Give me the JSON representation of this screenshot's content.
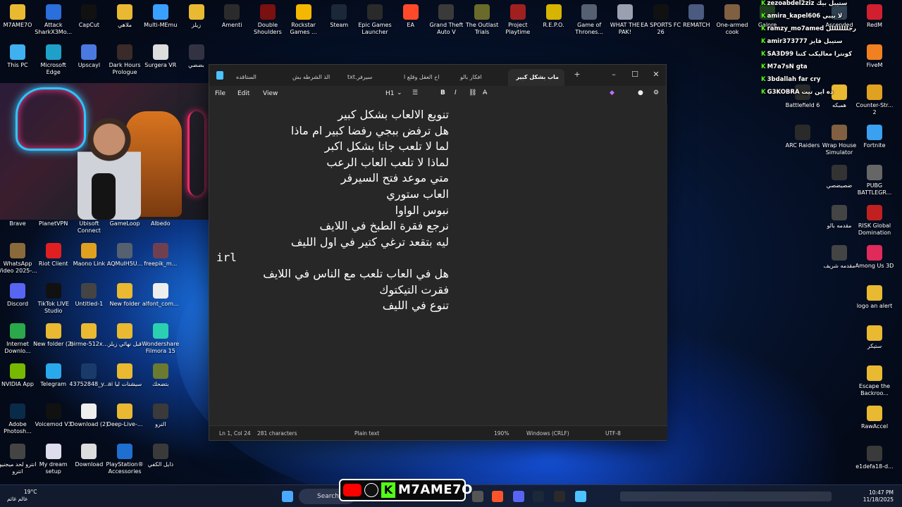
{
  "desktop": {
    "icons_left": [
      {
        "label": "M7AME7O",
        "icon": "folder-icon",
        "color": "#e8b931"
      },
      {
        "label": "Attack SharkX3Mo...",
        "icon": "shark-icon",
        "color": "#2a6fdb"
      },
      {
        "label": "CapCut",
        "icon": "capcut-icon",
        "color": "#111111"
      },
      {
        "label": "ملاهي",
        "icon": "folder-icon",
        "color": "#e8b931"
      },
      {
        "label": "Multi-MEmu",
        "icon": "memu-icon",
        "color": "#3aa0ff"
      },
      {
        "label": "زيلز",
        "icon": "folder-icon",
        "color": "#e8b931"
      },
      {
        "label": "Amenti",
        "icon": "game-icon",
        "color": "#2b2b2b"
      },
      {
        "label": "Double Shoulders",
        "icon": "game-icon",
        "color": "#7a1010"
      },
      {
        "label": "Rockstar Games ...",
        "icon": "rockstar-icon",
        "color": "#f5b800"
      },
      {
        "label": "Steam",
        "icon": "steam-icon",
        "color": "#1b2838"
      },
      {
        "label": "Epic Games Launcher",
        "icon": "epic-icon",
        "color": "#2a2a2a"
      },
      {
        "label": "EA",
        "icon": "ea-icon",
        "color": "#ff4a2a"
      },
      {
        "label": "Grand Theft Auto V",
        "icon": "gta-icon",
        "color": "#3a3a3a"
      },
      {
        "label": "The Outlast Trials",
        "icon": "game-icon",
        "color": "#6a6a2a"
      },
      {
        "label": "Project Playtime",
        "icon": "game-icon",
        "color": "#a02020"
      },
      {
        "label": "R.E.P.O.",
        "icon": "game-icon",
        "color": "#d6b400"
      },
      {
        "label": "Game of Thrones...",
        "icon": "game-icon",
        "color": "#556070"
      },
      {
        "label": "WHAT THE PAK!",
        "icon": "game-icon",
        "color": "#9aa0b0"
      },
      {
        "label": "EA SPORTS FC 26",
        "icon": "game-icon",
        "color": "#111111"
      },
      {
        "label": "REMATCH",
        "icon": "game-icon",
        "color": "#4a5a80"
      },
      {
        "label": "One-armed cook",
        "icon": "game-icon",
        "color": "#806040"
      }
    ],
    "row2": [
      {
        "label": "This PC",
        "icon": "pc-icon",
        "color": "#3fb0f0"
      },
      {
        "label": "Microsoft Edge",
        "icon": "edge-icon",
        "color": "#1fa0c8"
      },
      {
        "label": "Upscayl",
        "icon": "upscayl-icon",
        "color": "#4a7ae0"
      },
      {
        "label": "Dark Hours Prologue",
        "icon": "game-icon",
        "color": "#3a2a2a"
      },
      {
        "label": "Surgera VR",
        "icon": "surgera-icon",
        "color": "#dddddd"
      },
      {
        "label": "بضضي",
        "icon": "shortcut-icon",
        "color": "#333344"
      }
    ],
    "left_column": [
      {
        "label": "Brave",
        "icon": "brave-icon",
        "color": "#fb542b"
      },
      {
        "label": "PlanetVPN",
        "icon": "vpn-icon",
        "color": "#2a8af0"
      },
      {
        "label": "Ubisoft Connect",
        "icon": "ubisoft-icon",
        "color": "#1a1a1a"
      },
      {
        "label": "GameLoop",
        "icon": "gameloop-icon",
        "color": "#1f6fe0"
      },
      {
        "label": "Albedo",
        "icon": "albedo-icon",
        "color": "#aaaaaa"
      },
      {
        "label": "WhatsApp Video 2025-...",
        "icon": "video-icon",
        "color": "#8a6a3a"
      },
      {
        "label": "Riot Client",
        "icon": "riot-icon",
        "color": "#e02020"
      },
      {
        "label": "Maono Link",
        "icon": "maono-icon",
        "color": "#e0a020"
      },
      {
        "label": "AQMulH5U...",
        "icon": "image-icon",
        "color": "#556070"
      },
      {
        "label": "freepik_m...",
        "icon": "image-icon",
        "color": "#704050"
      },
      {
        "label": "Discord",
        "icon": "discord-icon",
        "color": "#5865f2"
      },
      {
        "label": "TikTok LIVE Studio",
        "icon": "tiktok-icon",
        "color": "#111111"
      },
      {
        "label": "Untitled-1",
        "icon": "file-icon",
        "color": "#444444"
      },
      {
        "label": "New folder",
        "icon": "folder-icon",
        "color": "#e8b931"
      },
      {
        "label": "alfont_com...",
        "icon": "font-icon",
        "color": "#eeeeee"
      },
      {
        "label": "Internet Downlo...",
        "icon": "idm-icon",
        "color": "#2aa84a"
      },
      {
        "label": "New folder (2)",
        "icon": "folder-icon",
        "color": "#e8b931"
      },
      {
        "label": "birme-512x...",
        "icon": "folder-icon",
        "color": "#e8b931"
      },
      {
        "label": "قبل نهائي زيلز",
        "icon": "folder-icon",
        "color": "#e8b931"
      },
      {
        "label": "Wondershare Filmora 15",
        "icon": "filmora-icon",
        "color": "#2ad0b0"
      },
      {
        "label": "NVIDIA App",
        "icon": "nvidia-icon",
        "color": "#76b900"
      },
      {
        "label": "Telegram",
        "icon": "telegram-icon",
        "color": "#29a9eb"
      },
      {
        "label": "43752848_y...",
        "icon": "psd-icon",
        "color": "#1a3a6a"
      },
      {
        "label": "ai سيشنات ليا",
        "icon": "folder-icon",
        "color": "#e8b931"
      },
      {
        "label": "بتضحك",
        "icon": "video-icon",
        "color": "#6a7a30"
      },
      {
        "label": "Adobe Photosh...",
        "icon": "photoshop-icon",
        "color": "#0a2a4a"
      },
      {
        "label": "Voicemod V3",
        "icon": "voicemod-icon",
        "color": "#111111"
      },
      {
        "label": "Download (2)",
        "icon": "image-icon",
        "color": "#eeeeee"
      },
      {
        "label": "Deep-Live-...",
        "icon": "folder-icon",
        "color": "#e8b931"
      },
      {
        "label": "النرو",
        "icon": "video-icon",
        "color": "#3a3a3a"
      },
      {
        "label": "انترو لحد ميجنيو انترو",
        "icon": "video-icon",
        "color": "#444444"
      },
      {
        "label": "My dream setup",
        "icon": "image-icon",
        "color": "#ddddee"
      },
      {
        "label": "Download",
        "icon": "file-icon",
        "color": "#dddddd"
      },
      {
        "label": "PlayStation® Accessories",
        "icon": "playstation-icon",
        "color": "#1f6fd0"
      },
      {
        "label": "ذايل الكفي",
        "icon": "video-icon",
        "color": "#3a3a3a"
      }
    ],
    "right_column": [
      {
        "label": "RedM",
        "icon": "redm-icon",
        "color": "#d02030"
      },
      {
        "label": "FiveM",
        "icon": "fivem-icon",
        "color": "#f08020"
      },
      {
        "label": "Counter-Str... 2",
        "icon": "cs2-icon",
        "color": "#e0a020"
      },
      {
        "label": "Battlefield 6",
        "icon": "game-icon",
        "color": "#2a2a2a"
      },
      {
        "label": "همبكه",
        "icon": "folder-icon",
        "color": "#e8b931"
      },
      {
        "label": "Fortnite",
        "icon": "fortnite-icon",
        "color": "#3aa0f0"
      },
      {
        "label": "ARC Raiders",
        "icon": "game-icon",
        "color": "#2a2a2a"
      },
      {
        "label": "Wrap House Simulator",
        "icon": "game-icon",
        "color": "#806040"
      },
      {
        "label": "PUBG BATTLEGR...",
        "icon": "pubg-icon",
        "color": "#666666"
      },
      {
        "label": "ضصيضصي",
        "icon": "video-icon",
        "color": "#333333"
      },
      {
        "label": "RISK Global Domination",
        "icon": "risk-icon",
        "color": "#c02020"
      },
      {
        "label": "مقدمه بالو",
        "icon": "video-icon",
        "color": "#444444"
      },
      {
        "label": "Among Us 3D",
        "icon": "amongus-icon",
        "color": "#e02a5a"
      },
      {
        "label": "مقدمه شريف",
        "icon": "video-icon",
        "color": "#444444"
      },
      {
        "label": "logo an alert",
        "icon": "folder-icon",
        "color": "#e8b931"
      },
      {
        "label": "ستيكر",
        "icon": "folder-icon",
        "color": "#e8b931"
      },
      {
        "label": "Escape the Backroo...",
        "icon": "folder-icon",
        "color": "#e8b931"
      },
      {
        "label": "RawAccel",
        "icon": "folder-icon",
        "color": "#e8b931"
      },
      {
        "label": "e1defa18-d...",
        "icon": "video-icon",
        "color": "#3a3a3a"
      },
      {
        "label": "Galore",
        "icon": "game-icon",
        "color": "#204020"
      },
      {
        "label": "Ascended",
        "icon": "game-icon",
        "color": "#304050"
      }
    ]
  },
  "chat": [
    {
      "user": "zezoabdel2ziz",
      "msg": "ستيبل بيك"
    },
    {
      "user": "amira_kapel606",
      "msg": "لا بيبي"
    },
    {
      "user": "ramzy_mo7amed",
      "msg": "رجلللللللل"
    },
    {
      "user": "amir373777",
      "msg": "ستيبل قايز"
    },
    {
      "user": "SA3D99",
      "msg": "كونترا معاليكب كتنا"
    },
    {
      "user": "M7a7sN",
      "msg": "gta"
    },
    {
      "user": "3bdallah",
      "msg": "far cry"
    },
    {
      "user": "G3KOBRA",
      "msg": "ده اين تيت"
    }
  ],
  "notepad": {
    "tabs": [
      {
        "label": "الستاقده",
        "active": false
      },
      {
        "label": "الذ الشرطه بش",
        "active": false
      },
      {
        "label": "سيرفر.txt",
        "active": false
      },
      {
        "label": "اخ العقل وقلع ا",
        "active": false
      },
      {
        "label": "افكار بالو",
        "active": false
      },
      {
        "label": "ماب بشكل كبير",
        "active": true
      }
    ],
    "menu": {
      "file": "File",
      "edit": "Edit",
      "view": "View",
      "heading": "H1"
    },
    "lines": [
      "تنويع الالعاب بشكل كبير",
      "هل ترفض ببجي رفضا كبير ام ماذا",
      "لما لا تلعب جاتا بشكل اكبر",
      "لماذا لا تلعب العاب الرعب",
      "متي موعد فتح السيرفر",
      "العاب ستوري",
      "نبوس الواوا",
      "نرجع فقرة الطبخ في اللايف",
      "ليه بتقعد ترغي كتير في اول الليف",
      "irl",
      "هل في العاب تلعب مع الناس في اللايف",
      "فقرت التيكتوك",
      "تنوع في الليف"
    ],
    "status": {
      "position": "Ln 1, Col 24",
      "chars": "281 characters",
      "format": "Plain text",
      "zoom": "190%",
      "line_ending": "Windows (CRLF)",
      "encoding": "UTF-8"
    }
  },
  "taskbar": {
    "weather_temp": "19°C",
    "weather_desc": "عالم غائم",
    "search_label": "Search",
    "brand": "M7AME7O",
    "time": "10:47 PM",
    "date": "11/18/2025"
  }
}
